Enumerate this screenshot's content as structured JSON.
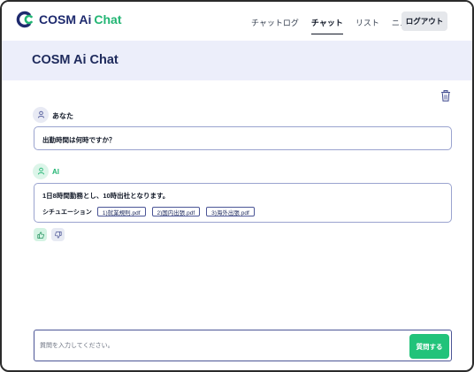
{
  "header": {
    "logo_prefix": "COSM Ai",
    "logo_suffix": "Chat",
    "nav": [
      {
        "label": "チャットログ",
        "active": false
      },
      {
        "label": "チャット",
        "active": true
      },
      {
        "label": "リスト",
        "active": false
      },
      {
        "label": "ニュース",
        "active": false
      }
    ],
    "logout_label": "ログアウト"
  },
  "hero": {
    "title": "COSM Ai Chat"
  },
  "conversation": {
    "user_message": {
      "sender": "あなた",
      "text": "出勤時間は何時ですか？"
    },
    "ai_message": {
      "sender": "AI",
      "text": "1日8時間勤務とし、10時出社となります。",
      "situation_label": "シチュエーション",
      "sources": [
        "1)就業規則.pdf",
        "2)国内出張.pdf",
        "3)海外出張.pdf"
      ]
    }
  },
  "input": {
    "placeholder": "質問を入力してください。",
    "value": "",
    "send_label": "質問する"
  },
  "icons": {
    "logo": "cosm-logo-icon",
    "trash": "trash-icon",
    "user_avatar": "user-icon",
    "ai_avatar": "user-icon",
    "thumbs_up": "thumbs-up-icon",
    "thumbs_down": "thumbs-down-icon"
  },
  "colors": {
    "brand_navy": "#1e2a6e",
    "brand_green": "#22b573",
    "send_button": "#22c37a",
    "hero_bg": "#eceefa",
    "bubble_border": "#9aa3cf"
  }
}
